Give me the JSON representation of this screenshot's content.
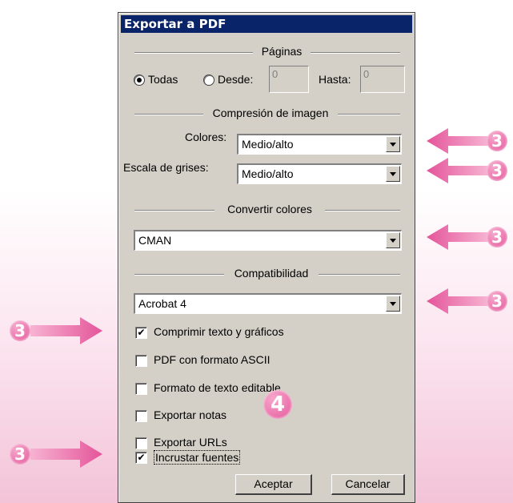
{
  "dialog": {
    "title": "Exportar a PDF",
    "pages_section": "Páginas",
    "radio_all": "Todas",
    "radio_from": "Desde:",
    "from_value": "0",
    "to_label": "Hasta:",
    "to_value": "0",
    "image_section": "Compresión de imagen",
    "colors_label": "Colores:",
    "colors_value": "Medio/alto",
    "gray_label": "Escala de grises:",
    "gray_value": "Medio/alto",
    "convert_section": "Convertir colores",
    "convert_value": "CMAN",
    "compat_section": "Compatibilidad",
    "compat_value": "Acrobat 4",
    "checkboxes": [
      {
        "label": "Comprimir texto y gráficos",
        "checked": true
      },
      {
        "label": "PDF con formato ASCII",
        "checked": false
      },
      {
        "label": "Formato de texto editable",
        "checked": false
      },
      {
        "label": "Exportar notas",
        "checked": false
      },
      {
        "label": "Exportar URLs",
        "checked": false
      },
      {
        "label": "Incrustar fuentes",
        "checked": true
      }
    ],
    "ok_label": "Aceptar",
    "cancel_label": "Cancelar"
  },
  "callouts": {
    "step3": "3",
    "step4": "4",
    "color": "#e4559a"
  }
}
